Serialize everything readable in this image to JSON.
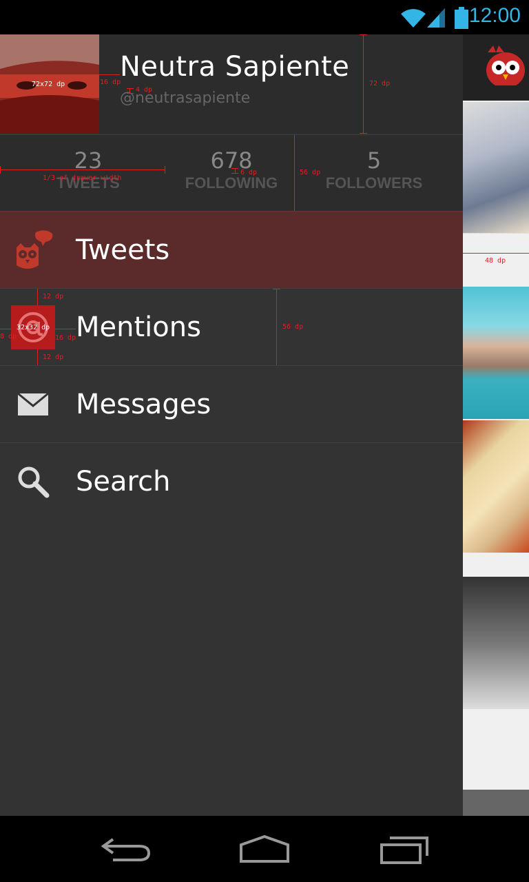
{
  "status_bar": {
    "time": "12:00",
    "icons": [
      "wifi-icon",
      "signal-icon",
      "battery-icon"
    ],
    "accent_color": "#33b5e5"
  },
  "profile": {
    "name": "Neutra Sapiente",
    "handle": "@neutrasapiente"
  },
  "stats": [
    {
      "value": "23",
      "label": "TWEETS"
    },
    {
      "value": "678",
      "label": "FOLLOWING"
    },
    {
      "value": "5",
      "label": "FOLLOWERS"
    }
  ],
  "menu": [
    {
      "label": "Tweets",
      "icon": "owl-tweet-icon",
      "active": true
    },
    {
      "label": "Mentions",
      "icon": "at-sign-icon",
      "active": false
    },
    {
      "label": "Messages",
      "icon": "envelope-icon",
      "active": false
    },
    {
      "label": "Search",
      "icon": "search-icon",
      "active": false
    }
  ],
  "specs": {
    "avatar_size": "72x72 dp",
    "avatar_gap": "16 dp",
    "name_handle_gap": "4 dp",
    "header_height": "72 dp",
    "stat_width": "1/3 of drawer width",
    "stat_gap": "6 dp",
    "stats_height": "56 dp",
    "icon_top": "12 dp",
    "icon_size": "32x32 dp",
    "icon_left": "8 dp",
    "icon_gap": "16 dp",
    "icon_bottom": "12 dp",
    "row_height": "56 dp",
    "content_width": "48 dp"
  },
  "colors": {
    "drawer_bg": "#333333",
    "active_row": "#5a2b2a",
    "brand_red": "#c62828"
  },
  "nav": [
    "back-icon",
    "home-icon",
    "recent-apps-icon"
  ]
}
